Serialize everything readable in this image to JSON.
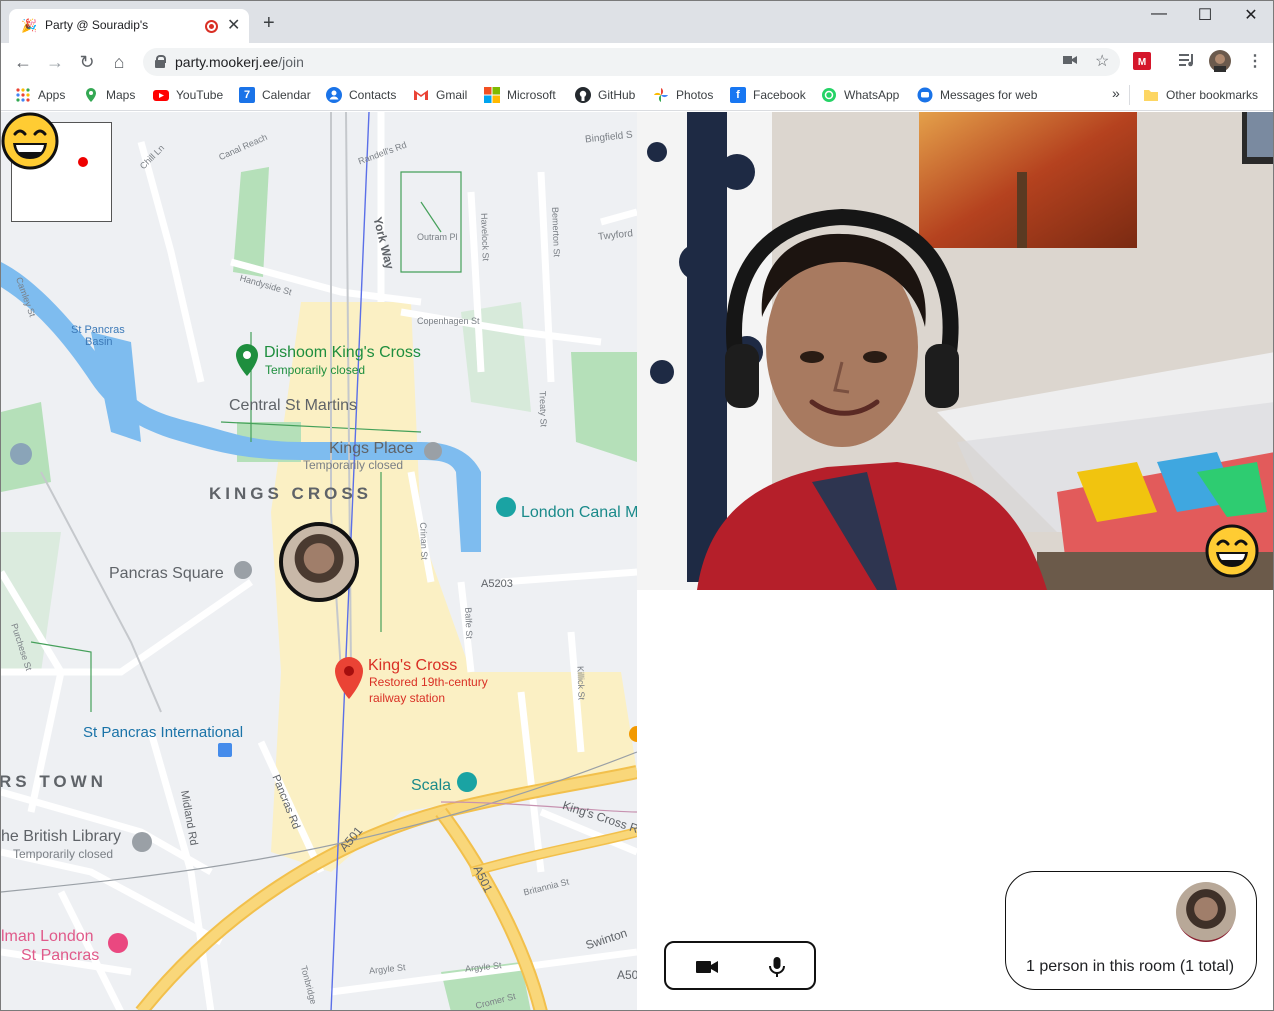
{
  "browser": {
    "tab": {
      "title": "Party @ Souradip's",
      "favicon": "party-popper-icon"
    },
    "new_tab_label": "+",
    "window_controls": {
      "minimize": "—",
      "maximize": "☐",
      "close": "✕"
    },
    "url": {
      "host": "party.mookerj.ee",
      "path": "/join"
    },
    "bookmarks": [
      "Apps",
      "Maps",
      "YouTube",
      "Calendar",
      "Contacts",
      "Gmail",
      "Microsoft",
      "GitHub",
      "Photos",
      "Facebook",
      "WhatsApp",
      "Messages for web"
    ],
    "calendar_day": "7",
    "overflow": "»",
    "other_bookmarks": "Other bookmarks"
  },
  "map": {
    "streets": [
      "Bingfield S",
      "Chill Ln",
      "Canal Reach",
      "Randell's Rd",
      "York Way",
      "Outram Pl",
      "Havelock St",
      "Bemerton St",
      "Twyford",
      "Handyside St",
      "Copenhagen St",
      "Camley St",
      "Treaty St",
      "Crinan St",
      "A5203",
      "Balfe St",
      "Killick St",
      "Purchese St",
      "Midland Rd",
      "Pancras Rd",
      "A501",
      "Britannia St",
      "Swinton",
      "Argyle St",
      "Cromer St",
      "Tonbridge",
      "King's Cross R",
      "A50"
    ],
    "places": [
      {
        "name": "St Pancras Basin",
        "lines": [
          "St Pancras",
          "Basin"
        ]
      },
      {
        "name": "Dishoom King's Cross",
        "sub": "Temporarily closed"
      },
      {
        "name": "Central St Martins"
      },
      {
        "name": "Kings Place",
        "sub": "Temporarily closed"
      },
      {
        "name": "KINGS CROSS"
      },
      {
        "name": "London Canal M"
      },
      {
        "name": "Pancras Square"
      },
      {
        "name": "King's Cross",
        "sub": "Restored 19th-century",
        "sub2": "railway station"
      },
      {
        "name": "St Pancras International"
      },
      {
        "name": "RS TOWN"
      },
      {
        "name": "he British Library",
        "sub": "Temporarily closed"
      },
      {
        "name": "Scala"
      },
      {
        "name": "lman London",
        "sub": "St Pancras"
      }
    ]
  },
  "room": {
    "status": "1 person in this room (1 total)"
  },
  "controls": {
    "camera": "video-camera-icon",
    "mic": "microphone-icon"
  },
  "colors": {
    "map_bg": "#eef0f3",
    "water": "#7ebcef",
    "park": "#b5e0b9",
    "station": "#fbf0c4",
    "road_major": "#f9d77a",
    "pin_red": "#ea4335",
    "pin_green": "#1e8e3e",
    "pin_teal": "#1aa3a3"
  }
}
